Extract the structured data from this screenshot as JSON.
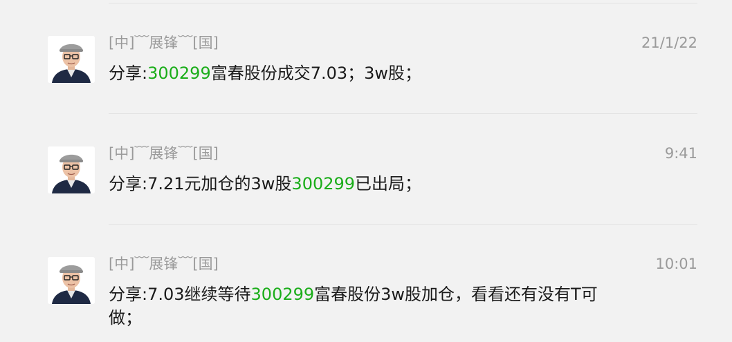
{
  "messages": [
    {
      "sender": "[中]﹋展锋﹋[国]",
      "time": "21/1/22",
      "text": {
        "prefix": "分享:",
        "code": "300299",
        "suffix": "富春股份成交7.03；3w股；"
      }
    },
    {
      "sender": "[中]﹋展锋﹋[国]",
      "time": "9:41",
      "text": {
        "prefix": "分享:7.21元加仓的3w股",
        "code": "300299",
        "suffix": "已出局；"
      }
    },
    {
      "sender": "[中]﹋展锋﹋[国]",
      "time": "10:01",
      "text": {
        "prefix": "分享:7.03继续等待",
        "code": "300299",
        "suffix": "富春股份3w股加仓，看看还有没有T可做；"
      }
    }
  ],
  "colors": {
    "background": "#f2f2f2",
    "stock_code": "#1aad19",
    "meta_text": "#9a9a9a",
    "body_text": "#1a1a1a"
  },
  "icons": {
    "avatar": "user-avatar-photo"
  }
}
